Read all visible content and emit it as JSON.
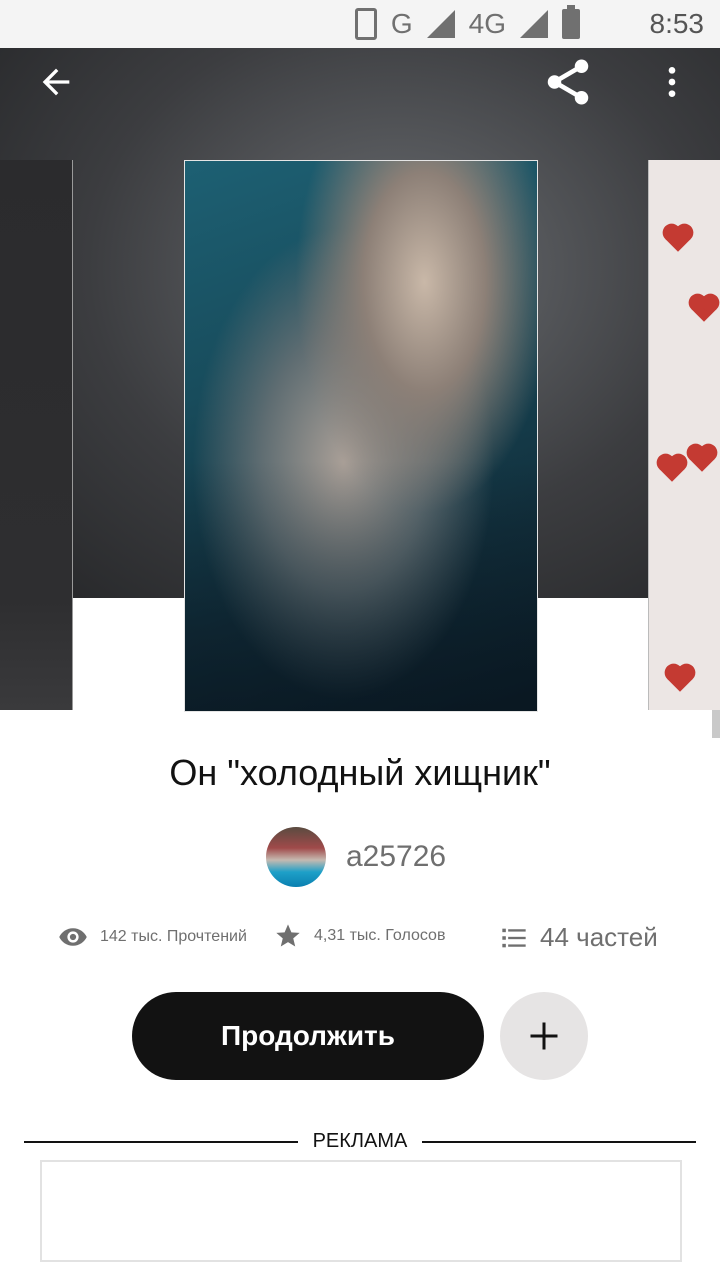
{
  "status_bar": {
    "time": "8:53",
    "network_labels": [
      "G",
      "4G"
    ],
    "icons": [
      "vibrate-icon",
      "signal-icon",
      "signal-4g-icon",
      "battery-icon"
    ]
  },
  "app_bar": {
    "icons": [
      "back-arrow-icon",
      "share-icon",
      "more-vert-icon"
    ]
  },
  "story": {
    "title": "Он \"холодный хищник\"",
    "author": "a25726",
    "stats": {
      "reads": "142 тыс. Прочтений",
      "votes": "4,31 тыс. Голосов",
      "parts": "44 частей"
    }
  },
  "actions": {
    "continue_label": "Продолжить",
    "add_icon": "plus-icon"
  },
  "ad": {
    "label": "РЕКЛАМА"
  },
  "colors": {
    "primary_dark": "#121212",
    "text_gray": "#6f6f6f",
    "add_button_bg": "#e6e4e4",
    "status_bar_bg": "#f4f4f4"
  }
}
